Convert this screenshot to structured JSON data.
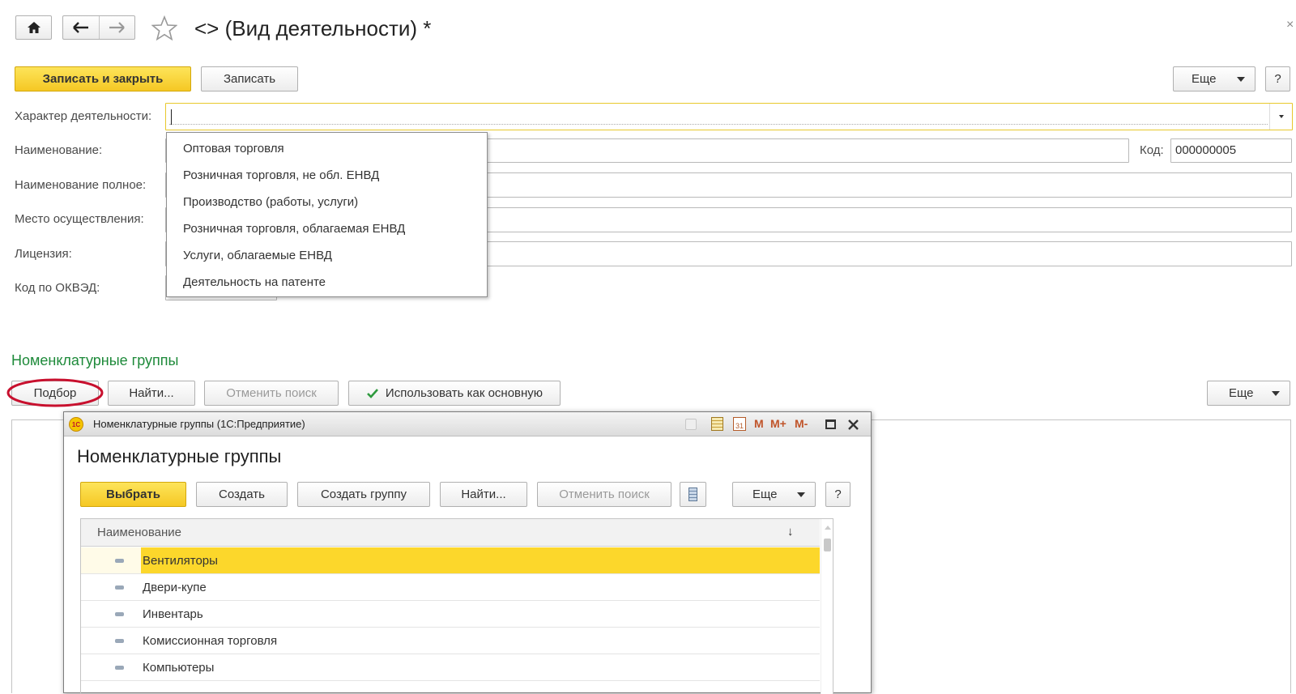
{
  "header": {
    "title": "<> (Вид деятельности) *"
  },
  "toolbar": {
    "save_close": "Записать и закрыть",
    "save": "Записать",
    "more": "Еще",
    "help": "?"
  },
  "form": {
    "activity_nature_label": "Характер деятельности:",
    "activity_nature_value": "",
    "name_label": "Наименование:",
    "code_label": "Код:",
    "code_value": "000000005",
    "full_name_label": "Наименование полное:",
    "place_label": "Место осуществления:",
    "license_label": "Лицензия:",
    "okved_label": "Код по ОКВЭД:"
  },
  "dropdown": {
    "options": [
      "Оптовая торговля",
      "Розничная торговля, не обл. ЕНВД",
      "Производство (работы, услуги)",
      "Розничная торговля, облагаемая ЕНВД",
      "Услуги, облагаемые ЕНВД",
      "Деятельность на патенте"
    ]
  },
  "groups_section": {
    "title": "Номенклатурные группы",
    "pick": "Подбор",
    "find": "Найти...",
    "cancel_search": "Отменить поиск",
    "use_as_main": "Использовать как основную",
    "more": "Еще"
  },
  "dialog": {
    "window_title": "Номенклатурные группы (1С:Предприятие)",
    "heading": "Номенклатурные группы",
    "app_icon": "1С",
    "mem_buttons": [
      "M",
      "M+",
      "M-"
    ],
    "calendar_day": "31",
    "select": "Выбрать",
    "create": "Создать",
    "create_group": "Создать группу",
    "find": "Найти...",
    "cancel_search": "Отменить поиск",
    "more": "Еще",
    "help": "?",
    "column_name": "Наименование",
    "sort_arrow": "↓",
    "rows": [
      "Вентиляторы",
      "Двери-купе",
      "Инвентарь",
      "Комиссионная торговля",
      "Компьютеры"
    ]
  },
  "colors": {
    "accent_yellow": "#f9d423",
    "section_green": "#1e8a3a",
    "highlight_oval": "#c8102e"
  }
}
